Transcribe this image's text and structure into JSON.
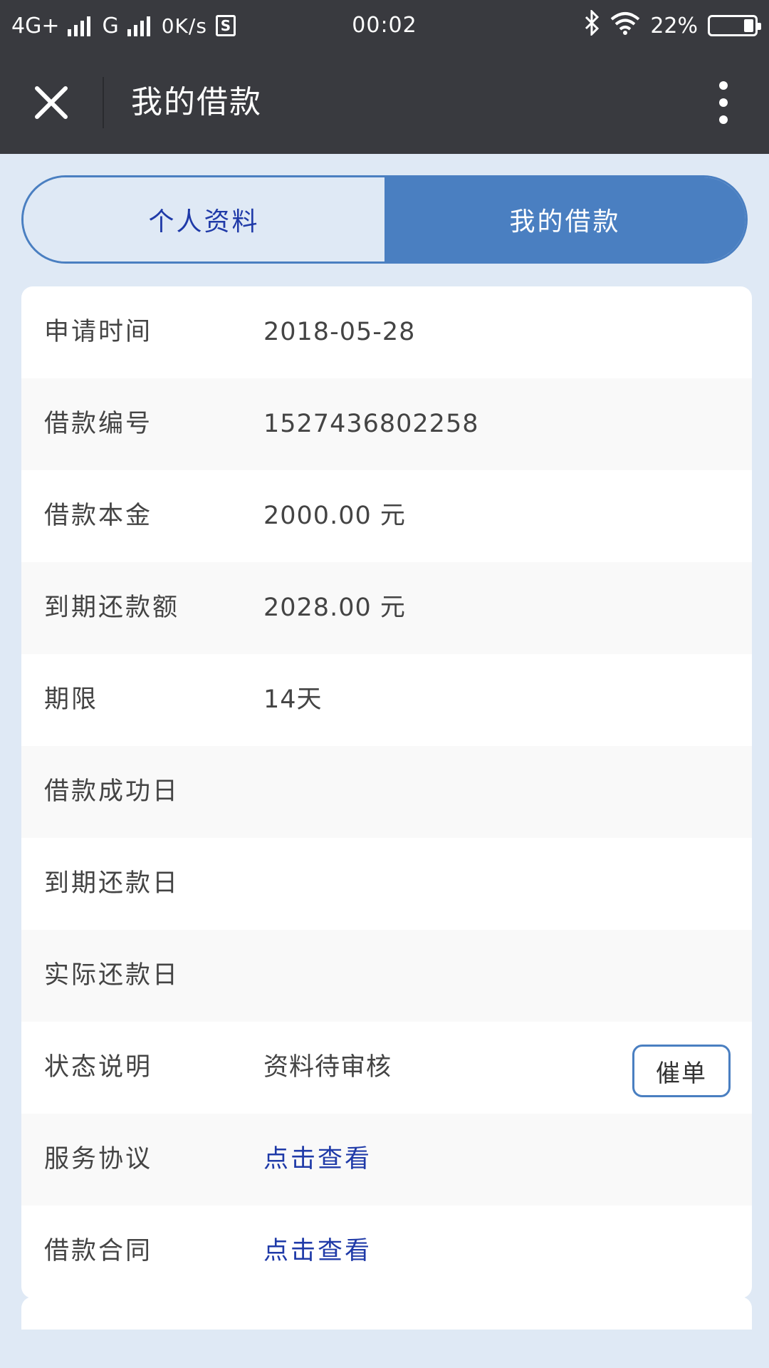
{
  "status_bar": {
    "network": "4G+",
    "network2": "G",
    "speed": "0K/s",
    "s_icon_text": "S",
    "time": "00:02",
    "battery_percent": "22%",
    "battery_level": 0.22
  },
  "title_bar": {
    "title": "我的借款"
  },
  "tabs": [
    {
      "label": "个人资料",
      "active": false
    },
    {
      "label": "我的借款",
      "active": true
    }
  ],
  "details": {
    "rows": [
      {
        "label": "申请时间",
        "value": "2018-05-28"
      },
      {
        "label": "借款编号",
        "value": "1527436802258"
      },
      {
        "label": "借款本金",
        "value": "2000.00 元"
      },
      {
        "label": "到期还款额",
        "value": "2028.00 元"
      },
      {
        "label": "期限",
        "value": "14天"
      },
      {
        "label": "借款成功日",
        "value": ""
      },
      {
        "label": "到期还款日",
        "value": ""
      },
      {
        "label": "实际还款日",
        "value": ""
      },
      {
        "label": "状态说明",
        "value": "资料待审核",
        "button": "催单"
      },
      {
        "label": "服务协议",
        "value": "点击查看"
      },
      {
        "label": "借款合同",
        "value": "点击查看"
      }
    ]
  },
  "colors": {
    "accent": "#4a7fc1",
    "link": "#1f3aa8",
    "header_bg": "#393a3f",
    "page_bg": "#dfe9f5"
  }
}
